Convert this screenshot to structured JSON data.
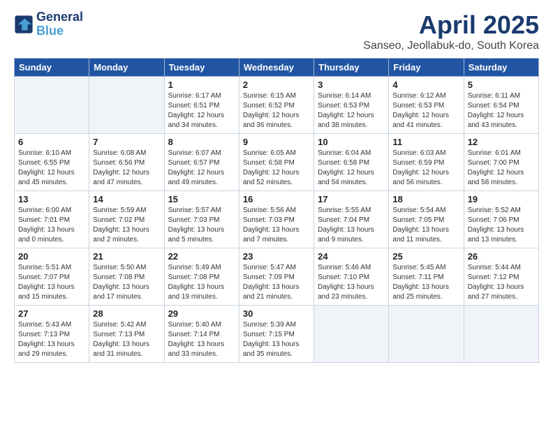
{
  "header": {
    "logo_line1": "General",
    "logo_line2": "Blue",
    "title": "April 2025",
    "subtitle": "Sanseo, Jeollabuk-do, South Korea"
  },
  "days_of_week": [
    "Sunday",
    "Monday",
    "Tuesday",
    "Wednesday",
    "Thursday",
    "Friday",
    "Saturday"
  ],
  "weeks": [
    [
      {
        "day": "",
        "info": ""
      },
      {
        "day": "",
        "info": ""
      },
      {
        "day": "1",
        "info": "Sunrise: 6:17 AM\nSunset: 6:51 PM\nDaylight: 12 hours and 34 minutes."
      },
      {
        "day": "2",
        "info": "Sunrise: 6:15 AM\nSunset: 6:52 PM\nDaylight: 12 hours and 36 minutes."
      },
      {
        "day": "3",
        "info": "Sunrise: 6:14 AM\nSunset: 6:53 PM\nDaylight: 12 hours and 38 minutes."
      },
      {
        "day": "4",
        "info": "Sunrise: 6:12 AM\nSunset: 6:53 PM\nDaylight: 12 hours and 41 minutes."
      },
      {
        "day": "5",
        "info": "Sunrise: 6:11 AM\nSunset: 6:54 PM\nDaylight: 12 hours and 43 minutes."
      }
    ],
    [
      {
        "day": "6",
        "info": "Sunrise: 6:10 AM\nSunset: 6:55 PM\nDaylight: 12 hours and 45 minutes."
      },
      {
        "day": "7",
        "info": "Sunrise: 6:08 AM\nSunset: 6:56 PM\nDaylight: 12 hours and 47 minutes."
      },
      {
        "day": "8",
        "info": "Sunrise: 6:07 AM\nSunset: 6:57 PM\nDaylight: 12 hours and 49 minutes."
      },
      {
        "day": "9",
        "info": "Sunrise: 6:05 AM\nSunset: 6:58 PM\nDaylight: 12 hours and 52 minutes."
      },
      {
        "day": "10",
        "info": "Sunrise: 6:04 AM\nSunset: 6:58 PM\nDaylight: 12 hours and 54 minutes."
      },
      {
        "day": "11",
        "info": "Sunrise: 6:03 AM\nSunset: 6:59 PM\nDaylight: 12 hours and 56 minutes."
      },
      {
        "day": "12",
        "info": "Sunrise: 6:01 AM\nSunset: 7:00 PM\nDaylight: 12 hours and 58 minutes."
      }
    ],
    [
      {
        "day": "13",
        "info": "Sunrise: 6:00 AM\nSunset: 7:01 PM\nDaylight: 13 hours and 0 minutes."
      },
      {
        "day": "14",
        "info": "Sunrise: 5:59 AM\nSunset: 7:02 PM\nDaylight: 13 hours and 2 minutes."
      },
      {
        "day": "15",
        "info": "Sunrise: 5:57 AM\nSunset: 7:03 PM\nDaylight: 13 hours and 5 minutes."
      },
      {
        "day": "16",
        "info": "Sunrise: 5:56 AM\nSunset: 7:03 PM\nDaylight: 13 hours and 7 minutes."
      },
      {
        "day": "17",
        "info": "Sunrise: 5:55 AM\nSunset: 7:04 PM\nDaylight: 13 hours and 9 minutes."
      },
      {
        "day": "18",
        "info": "Sunrise: 5:54 AM\nSunset: 7:05 PM\nDaylight: 13 hours and 11 minutes."
      },
      {
        "day": "19",
        "info": "Sunrise: 5:52 AM\nSunset: 7:06 PM\nDaylight: 13 hours and 13 minutes."
      }
    ],
    [
      {
        "day": "20",
        "info": "Sunrise: 5:51 AM\nSunset: 7:07 PM\nDaylight: 13 hours and 15 minutes."
      },
      {
        "day": "21",
        "info": "Sunrise: 5:50 AM\nSunset: 7:08 PM\nDaylight: 13 hours and 17 minutes."
      },
      {
        "day": "22",
        "info": "Sunrise: 5:49 AM\nSunset: 7:08 PM\nDaylight: 13 hours and 19 minutes."
      },
      {
        "day": "23",
        "info": "Sunrise: 5:47 AM\nSunset: 7:09 PM\nDaylight: 13 hours and 21 minutes."
      },
      {
        "day": "24",
        "info": "Sunrise: 5:46 AM\nSunset: 7:10 PM\nDaylight: 13 hours and 23 minutes."
      },
      {
        "day": "25",
        "info": "Sunrise: 5:45 AM\nSunset: 7:11 PM\nDaylight: 13 hours and 25 minutes."
      },
      {
        "day": "26",
        "info": "Sunrise: 5:44 AM\nSunset: 7:12 PM\nDaylight: 13 hours and 27 minutes."
      }
    ],
    [
      {
        "day": "27",
        "info": "Sunrise: 5:43 AM\nSunset: 7:13 PM\nDaylight: 13 hours and 29 minutes."
      },
      {
        "day": "28",
        "info": "Sunrise: 5:42 AM\nSunset: 7:13 PM\nDaylight: 13 hours and 31 minutes."
      },
      {
        "day": "29",
        "info": "Sunrise: 5:40 AM\nSunset: 7:14 PM\nDaylight: 13 hours and 33 minutes."
      },
      {
        "day": "30",
        "info": "Sunrise: 5:39 AM\nSunset: 7:15 PM\nDaylight: 13 hours and 35 minutes."
      },
      {
        "day": "",
        "info": ""
      },
      {
        "day": "",
        "info": ""
      },
      {
        "day": "",
        "info": ""
      }
    ]
  ]
}
